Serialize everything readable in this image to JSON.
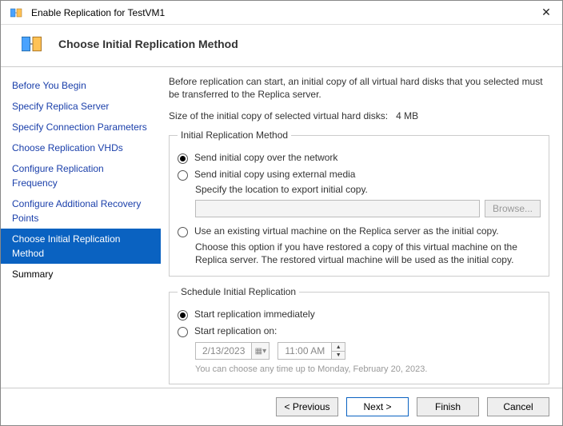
{
  "window": {
    "title": "Enable Replication for TestVM1"
  },
  "header": {
    "title": "Choose Initial Replication Method"
  },
  "sidebar": {
    "steps": [
      "Before You Begin",
      "Specify Replica Server",
      "Specify Connection Parameters",
      "Choose Replication VHDs",
      "Configure Replication Frequency",
      "Configure Additional Recovery Points",
      "Choose Initial Replication Method",
      "Summary"
    ],
    "active_index": 6
  },
  "main": {
    "intro": "Before replication can start, an initial copy of all virtual hard disks that you selected must be transferred to the Replica server.",
    "size_label": "Size of the initial copy of selected virtual hard disks:",
    "size_value": "4 MB"
  },
  "method": {
    "legend": "Initial Replication Method",
    "opt_network": "Send initial copy over the network",
    "opt_external": "Send initial copy using external media",
    "external_sublabel": "Specify the location to export initial copy.",
    "browse": "Browse...",
    "opt_existing": "Use an existing virtual machine on the Replica server as the initial copy.",
    "existing_desc": "Choose this option if you have restored a copy of this virtual machine on the Replica server. The restored virtual machine will be used as the initial copy.",
    "selected": "network"
  },
  "schedule": {
    "legend": "Schedule Initial Replication",
    "opt_now": "Start replication immediately",
    "opt_on": "Start replication on:",
    "date": "2/13/2023",
    "time": "11:00 AM",
    "hint": "You can choose any time up to Monday, February 20, 2023.",
    "selected": "now"
  },
  "footer": {
    "previous": "< Previous",
    "next": "Next >",
    "finish": "Finish",
    "cancel": "Cancel"
  }
}
